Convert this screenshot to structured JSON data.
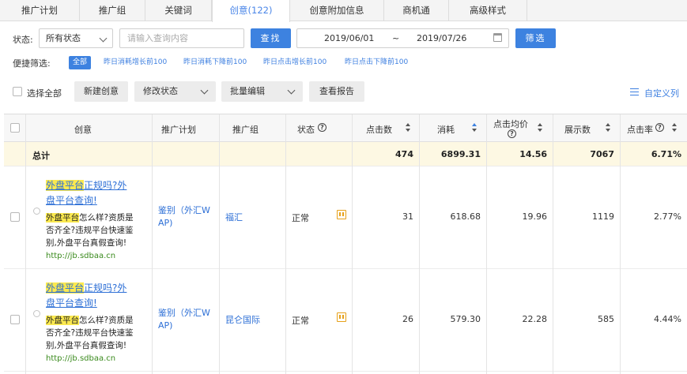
{
  "tabs": [
    {
      "label": "推广计划"
    },
    {
      "label": "推广组"
    },
    {
      "label": "关键词"
    },
    {
      "label": "创意(122)"
    },
    {
      "label": "创意附加信息"
    },
    {
      "label": "商机通"
    },
    {
      "label": "高级样式"
    }
  ],
  "filter": {
    "status_label": "状态:",
    "status_value": "所有状态",
    "search_placeholder": "请输入查询内容",
    "search_button": "查找",
    "date_start": "2019/06/01",
    "date_sep": "~",
    "date_end": "2019/07/26",
    "filter_button": "筛选"
  },
  "quick": {
    "label": "便捷筛选:",
    "items": [
      "全部",
      "昨日消耗增长前100",
      "昨日消耗下降前100",
      "昨日点击增长前100",
      "昨日点击下降前100"
    ]
  },
  "toolbar": {
    "select_all": "选择全部",
    "new_creative": "新建创意",
    "modify_status": "修改状态",
    "bulk_edit": "批量编辑",
    "view_report": "查看报告",
    "custom_columns": "自定义列"
  },
  "table": {
    "headers": {
      "creative": "创意",
      "plan": "推广计划",
      "group": "推广组",
      "status": "状态",
      "clicks": "点击数",
      "cost": "消耗",
      "cpc_line1": "点击均价",
      "impressions": "展示数",
      "ctr": "点击率"
    },
    "total": {
      "label": "总计",
      "clicks": "474",
      "cost": "6899.31",
      "cpc": "14.56",
      "impressions": "7067",
      "ctr": "6.71%"
    },
    "rows": [
      {
        "title_hl": "外盘平台",
        "title_rest_1": "正规吗?外",
        "title_rest_2": "盘平台查询!",
        "desc_hl": "外盘平台",
        "desc_1": "怎么样?资质是",
        "desc_2": "否齐全?违规平台快速鉴",
        "desc_3": "别,外盘平台真假查询!",
        "url": "http://jb.sdbaa.cn",
        "plan_1": "鉴别（外汇W",
        "plan_2": "AP)",
        "group": "福汇",
        "status": "正常",
        "clicks": "31",
        "cost": "618.68",
        "cpc": "19.96",
        "impressions": "1119",
        "ctr": "2.77%"
      },
      {
        "title_hl": "外盘平台",
        "title_rest_1": "正规吗?外",
        "title_rest_2": "盘平台查询!",
        "desc_hl": "外盘平台",
        "desc_1": "怎么样?资质是",
        "desc_2": "否齐全?违规平台快速鉴",
        "desc_3": "别,外盘平台真假查询!",
        "url": "http://jb.sdbaa.cn",
        "plan_1": "鉴别（外汇W",
        "plan_2": "AP)",
        "group": "昆仑国际",
        "status": "正常",
        "clicks": "26",
        "cost": "579.30",
        "cpc": "22.28",
        "impressions": "585",
        "ctr": "4.44%"
      }
    ]
  },
  "colors": {
    "accent": "#3d82e0",
    "link": "#2d6fd6",
    "highlight": "#fbe94f",
    "total_bg": "#fdf8e3",
    "url_green": "#3a8a1d",
    "edit_icon": "#e6a11a"
  }
}
